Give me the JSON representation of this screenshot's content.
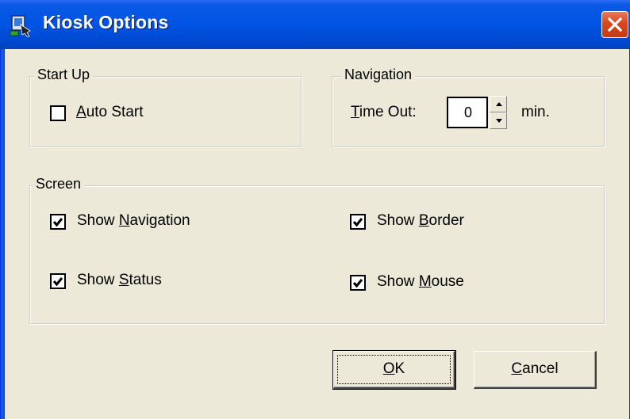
{
  "window": {
    "title": "Kiosk Options",
    "app_icon": "kiosk-app-icon",
    "close_icon": "close-icon",
    "close_color": "#d9461e",
    "titlebar_color": "#0054e3",
    "background_color": "#ece9d8"
  },
  "startup": {
    "group_label": "Start Up",
    "auto_start": {
      "label_mnemonic": "A",
      "label_rest": "uto Start",
      "checked": false
    }
  },
  "navigation": {
    "group_label": "Navigation",
    "timeout_mnemonic": "T",
    "timeout_label_rest": "ime Out:",
    "timeout_value": "0",
    "timeout_unit": "min."
  },
  "screen": {
    "group_label": "Screen",
    "show_navigation": {
      "label_prefix": "Show ",
      "mnemonic": "N",
      "label_rest": "avigation",
      "checked": true
    },
    "show_status": {
      "label_prefix": "Show ",
      "mnemonic": "S",
      "label_rest": "tatus",
      "checked": true
    },
    "show_border": {
      "label_prefix": "Show ",
      "mnemonic": "B",
      "label_rest": "order",
      "checked": true
    },
    "show_mouse": {
      "label_prefix": "Show ",
      "mnemonic": "M",
      "label_rest": "ouse",
      "checked": true
    }
  },
  "buttons": {
    "ok": {
      "mnemonic": "O",
      "rest": "K"
    },
    "cancel": {
      "mnemonic": "C",
      "rest": "ancel"
    }
  }
}
